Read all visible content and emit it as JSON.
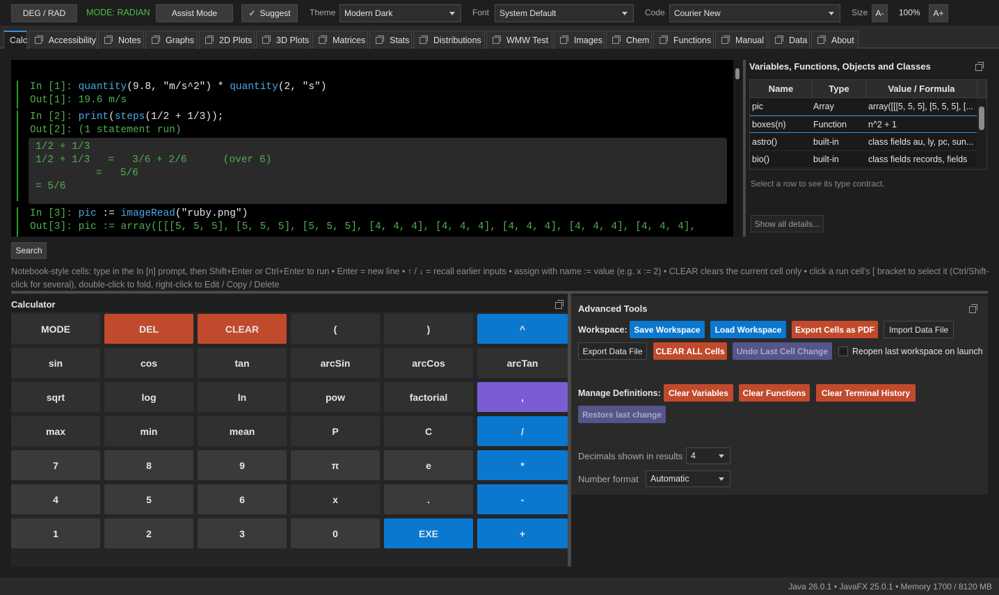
{
  "toolbar": {
    "deg_rad": "DEG / RAD",
    "mode": "MODE: RADIAN",
    "assist": "Assist Mode",
    "suggest": "Suggest",
    "suggest_check": "✓",
    "theme_label": "Theme",
    "theme_value": "Modern Dark",
    "font_label": "Font",
    "font_value": "System Default",
    "code_label": "Code",
    "code_value": "Courier New",
    "size_label": "Size",
    "size_minus": "A-",
    "zoom": "100%",
    "size_plus": "A+",
    "mode_color": "#46c046"
  },
  "tabs": [
    "Calc",
    "Accessibility",
    "Notes",
    "Graphs",
    "2D Plots",
    "3D Plots",
    "Matrices",
    "Stats",
    "Distributions",
    "WMW Test",
    "Images",
    "Chem",
    "Functions",
    "Manual",
    "Data",
    "About"
  ],
  "notebook": {
    "cell1_in_prompt": "In [1]: ",
    "cell1_in_f1": "quantity",
    "cell1_in_a1": "(9.8, ",
    "cell1_in_s1": "\"m/s^2\"",
    "cell1_in_op": ") * ",
    "cell1_in_f2": "quantity",
    "cell1_in_a2": "(2, ",
    "cell1_in_s2": "\"s\"",
    "cell1_in_close": ")",
    "cell1_out_prompt": "Out[1]: ",
    "cell1_out": "19.6 m/s",
    "cell2_in_prompt": "In [2]: ",
    "cell2_in_f1": "print",
    "cell2_in_p1": "(",
    "cell2_in_f2": "steps",
    "cell2_in_rest": "(1/2 + 1/3));",
    "cell2_out_prompt": "Out[2]: ",
    "cell2_out": "(1 statement run)",
    "steps": [
      "1/2 + 1/3",
      "1/2 + 1/3   =   3/6 + 2/6      (over 6)",
      "          =   5/6",
      "= 5/6"
    ],
    "cell3_in_prompt": "In [3]: ",
    "cell3_in_var": "pic",
    "cell3_in_assign": " := ",
    "cell3_in_f1": "imageRead",
    "cell3_in_p1": "(",
    "cell3_in_s1": "\"ruby.png\"",
    "cell3_in_close": ")",
    "cell3_out_prompt": "Out[3]: ",
    "cell3_out": "pic := array([[[5, 5, 5], [5, 5, 5], [5, 5, 5], [4, 4, 4], [4, 4, 4], [4, 4, 4], [4, 4, 4], [4, 4, 4],"
  },
  "vars": {
    "title": "Variables, Functions, Objects and Classes",
    "headers": [
      "Name",
      "Type",
      "Value / Formula"
    ],
    "rows": [
      [
        "pic",
        "Array",
        "array([[[5, 5, 5], [5, 5, 5], [..."
      ],
      [
        "boxes(n)",
        "Function",
        "n^2 + 1"
      ],
      [
        "astro()",
        "built-in",
        "class fields au, ly, pc, sun..."
      ],
      [
        "bio()",
        "built-in",
        "class fields records, fields"
      ]
    ],
    "hint": "Select a row to see its type contract.",
    "show_details": "Show all details..."
  },
  "search_label": "Search",
  "help_text": "Notebook-style cells: type in the In [n] prompt, then Shift+Enter or Ctrl+Enter to run  •  Enter = new line  •  ↑ / ↓ = recall earlier inputs  •  assign with  name := value  (e.g. x := 2)  •  CLEAR clears the current cell only  •  click a run cell's [ bracket to select it (Ctrl/Shift-click for several), double-click to fold, right-click to Edit / Copy / Delete",
  "calculator": {
    "title": "Calculator",
    "keys": [
      "MODE",
      "DEL",
      "CLEAR",
      "(",
      ")",
      "^",
      "sin",
      "cos",
      "tan",
      "arcSin",
      "arcCos",
      "arcTan",
      "sqrt",
      "log",
      "ln",
      "pow",
      "factorial",
      ",",
      "max",
      "min",
      "mean",
      "P",
      "C",
      "/",
      "7",
      "8",
      "9",
      "π",
      "e",
      "*",
      "4",
      "5",
      "6",
      "x",
      ".",
      "-",
      "1",
      "2",
      "3",
      "0",
      "EXE",
      "+"
    ]
  },
  "advanced": {
    "title": "Advanced Tools",
    "workspace_label": "Workspace:",
    "save_workspace": "Save Workspace",
    "load_workspace": "Load Workspace",
    "export_pdf": "Export Cells as PDF",
    "import_data": "Import Data File",
    "export_data": "Export Data File",
    "clear_all": "CLEAR ALL Cells",
    "undo_last": "Undo Last Cell Change",
    "reopen_label": "Reopen last workspace on launch",
    "manage_label": "Manage Definitions:",
    "clear_vars": "Clear Variables",
    "clear_funcs": "Clear Functions",
    "clear_history": "Clear Terminal History",
    "restore": "Restore last change",
    "decimals_label": "Decimals shown in results",
    "decimals_value": "4",
    "format_label": "Number format",
    "format_value": "Automatic"
  },
  "status": "Java 26.0.1  •  JavaFX 25.0.1  •  Memory 1700 / 8120 MB",
  "colors": {
    "accent_blue": "#0b78d0",
    "danger_red": "#c24a2c",
    "purple": "#7c5cd4",
    "prompt_green": "#4fb04f",
    "code_blue": "#4aa8e8"
  }
}
